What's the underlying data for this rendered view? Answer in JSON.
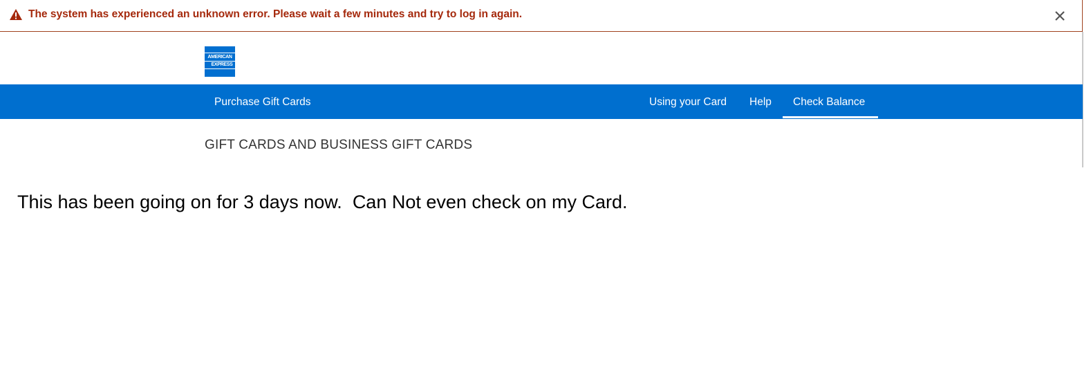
{
  "error_banner": {
    "icon": "warning-triangle-icon",
    "message": "The system has experienced an unknown error. Please wait a few minutes and try to log in again.",
    "close_icon": "close-icon",
    "color": "#a5290c"
  },
  "header": {
    "logo_lines": [
      "AMERICAN",
      "EXPRESS"
    ],
    "logo_color": "#016fd0"
  },
  "nav": {
    "background": "#006fcf",
    "left_item": "Purchase Gift Cards",
    "right_items": [
      "Using your Card",
      "Help",
      "Check Balance"
    ],
    "active_item": "Check Balance"
  },
  "main": {
    "section_title": "GIFT CARDS AND BUSINESS GIFT CARDS",
    "comment": "This has been going on for 3 days now.  Can Not even check on my Card."
  }
}
